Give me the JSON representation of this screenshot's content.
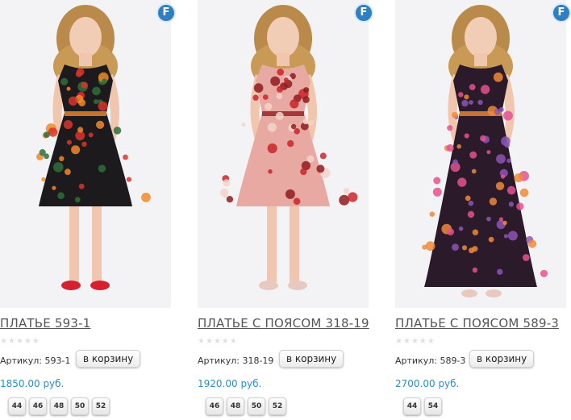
{
  "brand_icon": {
    "letter": "F",
    "icon": "brand-logo-f-icon",
    "color": "#2f7fc1"
  },
  "rating_icon": "star-icon",
  "products": [
    {
      "title": "ПЛАТЬЕ 593-1",
      "sku_label": "Артикул: 593-1",
      "cart_label": "в корзину",
      "price": "1850.00 руб.",
      "sizes": [
        "44",
        "46",
        "48",
        "50",
        "52"
      ],
      "rating_stars": 5,
      "dress_color": "#1d1a1e",
      "print_colors": [
        "#d8352b",
        "#f08a2a",
        "#2f6d3a"
      ]
    },
    {
      "title": "ПЛАТЬЕ С ПОЯСОМ 318-19",
      "sku_label": "Артикул: 318-19",
      "cart_label": "в корзину",
      "price": "1920.00 руб.",
      "sizes": [
        "46",
        "48",
        "50",
        "52"
      ],
      "rating_stars": 5,
      "dress_color": "#e8a9a3",
      "print_colors": [
        "#c9242c",
        "#8e1b1f",
        "#f2d3ca"
      ]
    },
    {
      "title": "ПЛАТЬЕ С ПОЯСОМ 589-3",
      "sku_label": "Артикул: 589-3",
      "cart_label": "в корзину",
      "price": "2700.00 руб.",
      "sizes": [
        "44",
        "54"
      ],
      "rating_stars": 5,
      "dress_color": "#2a1a2a",
      "print_colors": [
        "#e4528f",
        "#f08a3a",
        "#8d55b5"
      ]
    }
  ]
}
